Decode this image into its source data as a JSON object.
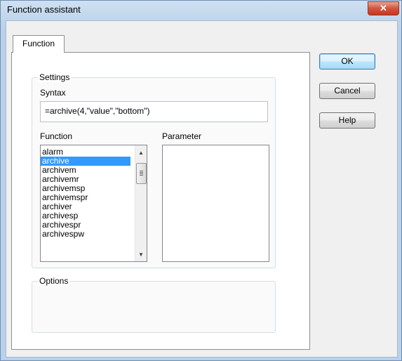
{
  "window": {
    "title": "Function assistant",
    "close_glyph": "✕"
  },
  "tabs": [
    {
      "label": "Function"
    }
  ],
  "settings": {
    "group_label": "Settings",
    "syntax_label": "Syntax",
    "syntax_value": "=archive(4,\"value\",\"bottom\")",
    "function_label": "Function",
    "parameter_label": "Parameter",
    "functions": [
      {
        "label": "alarm"
      },
      {
        "label": "archive",
        "selected": true
      },
      {
        "label": "archivem"
      },
      {
        "label": "archivemr"
      },
      {
        "label": "archivemsp"
      },
      {
        "label": "archivemspr"
      },
      {
        "label": "archiver"
      },
      {
        "label": "archivesp"
      },
      {
        "label": "archivespr"
      },
      {
        "label": "archivespw"
      }
    ],
    "parameters": []
  },
  "options": {
    "group_label": "Options"
  },
  "buttons": {
    "ok": "OK",
    "cancel": "Cancel",
    "help": "Help"
  },
  "icons": {
    "scroll_up": "▲",
    "scroll_down": "▼"
  }
}
